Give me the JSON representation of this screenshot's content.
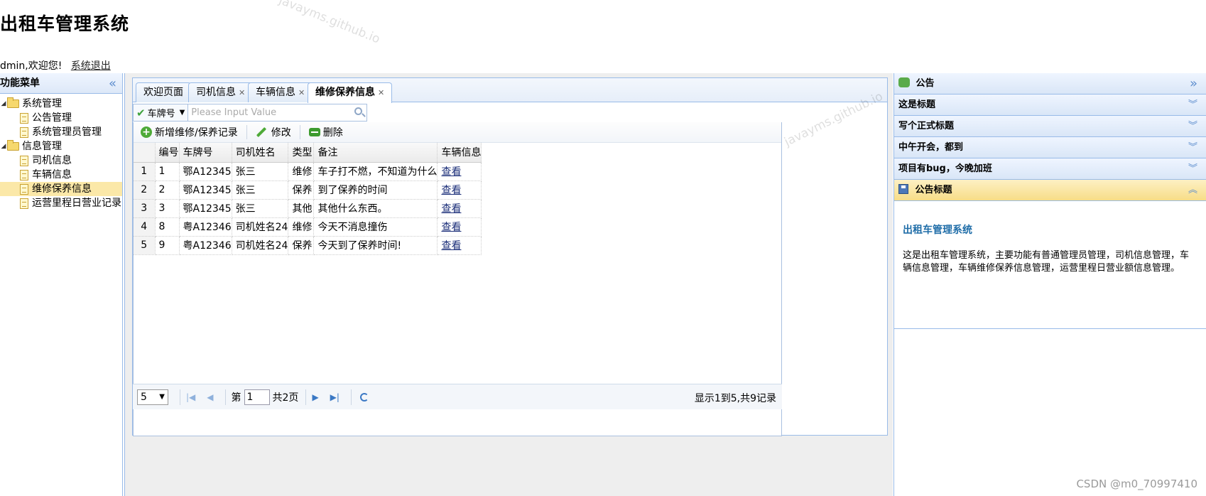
{
  "header": {
    "app_title": "出租车管理系统",
    "greeting": "dmin,欢迎您!",
    "logout_label": "系统退出"
  },
  "left_menu": {
    "title": "功能菜单",
    "collapse_icon": "double-chevron-left-icon",
    "groups": [
      {
        "label": "系统管理",
        "items": [
          "公告管理",
          "系统管理员管理"
        ]
      },
      {
        "label": "信息管理",
        "items": [
          "司机信息",
          "车辆信息",
          "维修保养信息",
          "运营里程日营业记录"
        ]
      }
    ],
    "selected_item": "维修保养信息"
  },
  "tabs": [
    {
      "label": "欢迎页面",
      "closable": false
    },
    {
      "label": "司机信息",
      "closable": true
    },
    {
      "label": "车辆信息",
      "closable": true
    },
    {
      "label": "维修保养信息",
      "closable": true,
      "active": true
    }
  ],
  "search": {
    "field_label": "车牌号",
    "placeholder": "Please Input Value"
  },
  "toolbar": {
    "add_label": "新增维修/保养记录",
    "edit_label": "修改",
    "delete_label": "删除"
  },
  "table": {
    "columns": [
      "编号",
      "车牌号",
      "司机姓名",
      "类型",
      "备注",
      "车辆信息"
    ],
    "rows": [
      {
        "rownum": "1",
        "id": "1",
        "plate": "鄂A12345",
        "driver": "张三",
        "type": "维修",
        "note": "车子打不燃，不知道为什么",
        "link": "查看"
      },
      {
        "rownum": "2",
        "id": "2",
        "plate": "鄂A12345",
        "driver": "张三",
        "type": "保养",
        "note": "到了保养的时间",
        "link": "查看"
      },
      {
        "rownum": "3",
        "id": "3",
        "plate": "鄂A12345",
        "driver": "张三",
        "type": "其他",
        "note": "其他什么东西。",
        "link": "查看"
      },
      {
        "rownum": "4",
        "id": "8",
        "plate": "粤A12346",
        "driver": "司机姓名24",
        "type": "维修",
        "note": "今天不消息撞伤",
        "link": "查看"
      },
      {
        "rownum": "5",
        "id": "9",
        "plate": "粤A12346",
        "driver": "司机姓名24",
        "type": "保养",
        "note": "今天到了保养时间!",
        "link": "查看"
      }
    ]
  },
  "pager": {
    "page_size": "5",
    "page_prefix": "第",
    "current_page": "1",
    "total_pages_label": "共2页",
    "info": "显示1到5,共9记录"
  },
  "notices": {
    "title": "公告",
    "collapsed_items": [
      "这是标题",
      "写个正式标题",
      "中午开会，都到",
      "项目有bug，今晚加班"
    ],
    "open_item": {
      "title": "公告标题",
      "body_title": "出租车管理系统",
      "body_text": "这是出租车管理系统，主要功能有普通管理员管理，司机信息管理，车辆信息管理，车辆维修保养信息管理，运营里程日营业额信息管理。"
    }
  },
  "watermark_text": "javayms.github.io",
  "csdn_mark": "CSDN @m0_70997410"
}
